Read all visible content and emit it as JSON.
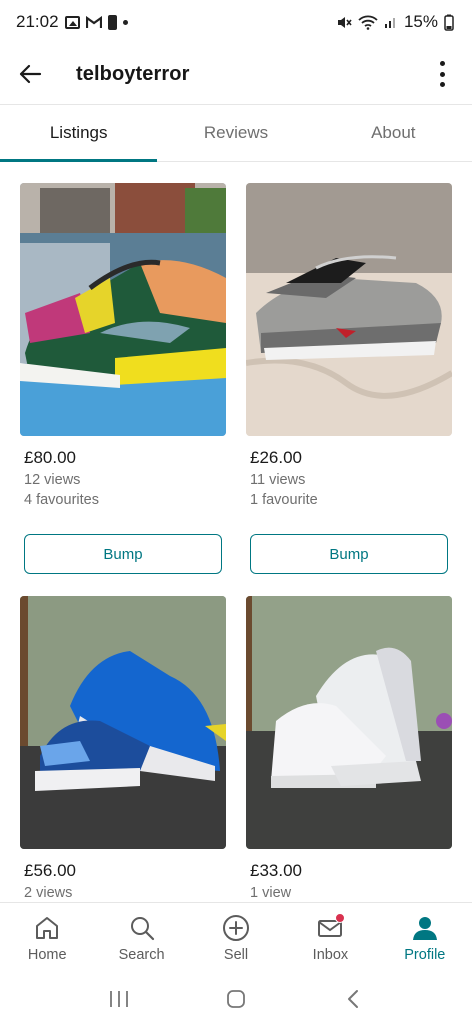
{
  "status_bar": {
    "time": "21:02",
    "battery": "15%"
  },
  "header": {
    "username": "telboyterror"
  },
  "tabs": [
    {
      "label": "Listings",
      "active": true
    },
    {
      "label": "Reviews",
      "active": false
    },
    {
      "label": "About",
      "active": false
    }
  ],
  "listings": [
    {
      "price": "£80.00",
      "views": "12 views",
      "favourites": "4 favourites",
      "bump_label": "Bump"
    },
    {
      "price": "£26.00",
      "views": "11 views",
      "favourites": "1 favourite",
      "bump_label": "Bump"
    },
    {
      "price": "£56.00",
      "views": "2 views"
    },
    {
      "price": "£33.00",
      "views": "1 view"
    }
  ],
  "bottom_nav": [
    {
      "label": "Home",
      "icon": "home-icon"
    },
    {
      "label": "Search",
      "icon": "search-icon"
    },
    {
      "label": "Sell",
      "icon": "plus-circle-icon"
    },
    {
      "label": "Inbox",
      "icon": "envelope-icon",
      "notification": true
    },
    {
      "label": "Profile",
      "icon": "person-icon",
      "active": true
    }
  ],
  "colors": {
    "accent": "#007782",
    "notification": "#d9314f"
  }
}
